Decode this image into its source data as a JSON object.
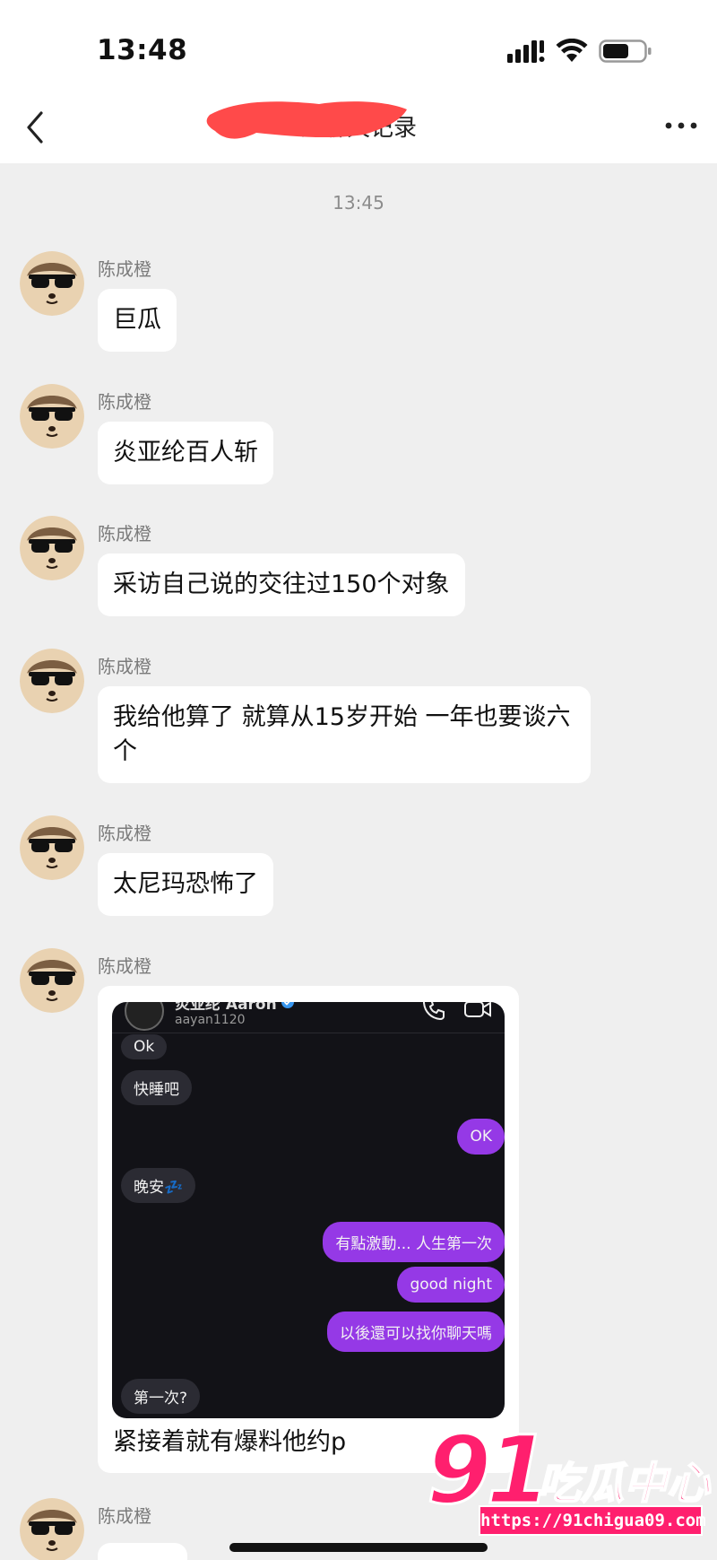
{
  "status_bar": {
    "time": "13:48"
  },
  "nav": {
    "title": "的聊天记录"
  },
  "chat": {
    "timestamp": "13:45",
    "messages": [
      {
        "sender": "陈成橙",
        "text": "巨瓜"
      },
      {
        "sender": "陈成橙",
        "text": "炎亚纶百人斩"
      },
      {
        "sender": "陈成橙",
        "text": "采访自己说的交往过150个对象"
      },
      {
        "sender": "陈成橙",
        "text": "我给他算了 就算从15岁开始 一年也要谈六个"
      },
      {
        "sender": "陈成橙",
        "text": "太尼玛恐怖了"
      },
      {
        "sender": "陈成橙",
        "caption": "紧接着就有爆料他约p",
        "screenshot": {
          "header_name": "炎亚纶 Aaron",
          "header_handle": "aayan1120",
          "bubbles": [
            {
              "side": "in",
              "text": "Ok"
            },
            {
              "side": "in",
              "text": "快睡吧"
            },
            {
              "side": "out",
              "text": "OK"
            },
            {
              "side": "in",
              "text": "晚安💤"
            },
            {
              "side": "out",
              "text": "有點激動... 人生第一次"
            },
            {
              "side": "out",
              "text": "good night"
            },
            {
              "side": "out",
              "text": "以後還可以找你聊天嗎"
            },
            {
              "side": "in",
              "text": "第一次?"
            }
          ]
        }
      },
      {
        "sender": "陈成橙"
      }
    ]
  },
  "watermark": {
    "number": "91",
    "text": "吃瓜中心",
    "url": "https://91chigua09.com"
  },
  "colors": {
    "background": "#efefef",
    "bubble": "#ffffff",
    "sender": "#7b7b7b",
    "ig_out": "#9539e6",
    "watermark": "#ff1f6e"
  },
  "icons": [
    "signal-icon",
    "wifi-icon",
    "battery-icon",
    "back-icon",
    "more-icon",
    "phone-icon",
    "video-icon",
    "verified-icon"
  ]
}
